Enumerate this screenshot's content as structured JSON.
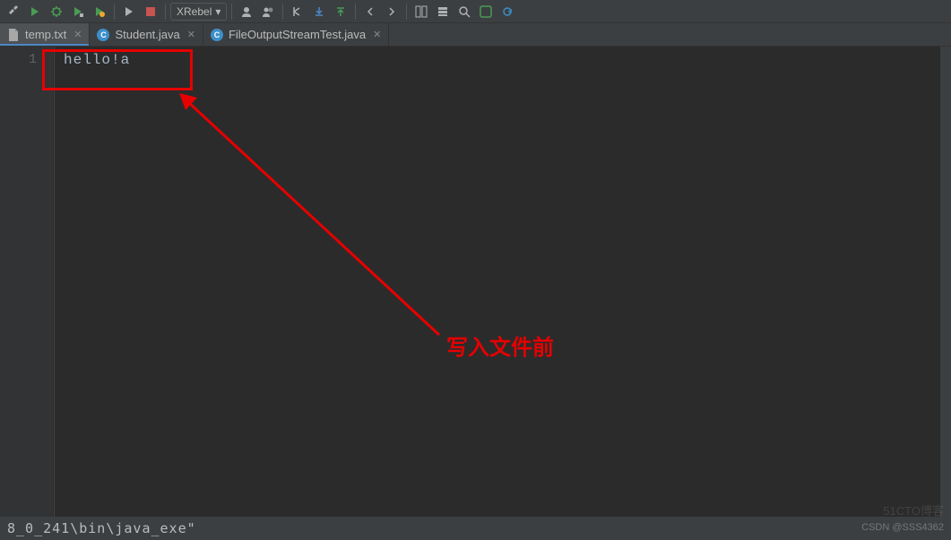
{
  "toolbar": {
    "dropdown_label": "XRebel"
  },
  "tabs": [
    {
      "label": "temp.txt",
      "icon": "file",
      "active": true
    },
    {
      "label": "Student.java",
      "icon": "java",
      "active": false
    },
    {
      "label": "FileOutputStreamTest.java",
      "icon": "java",
      "active": false
    }
  ],
  "editor": {
    "line_number": "1",
    "content": "hello!a"
  },
  "annotation": {
    "text": "写入文件前"
  },
  "bottom": {
    "text": "8_0_241\\bin\\java_exe\""
  },
  "watermark": "CSDN @SSS4362",
  "watermark2": "51CTO博客"
}
